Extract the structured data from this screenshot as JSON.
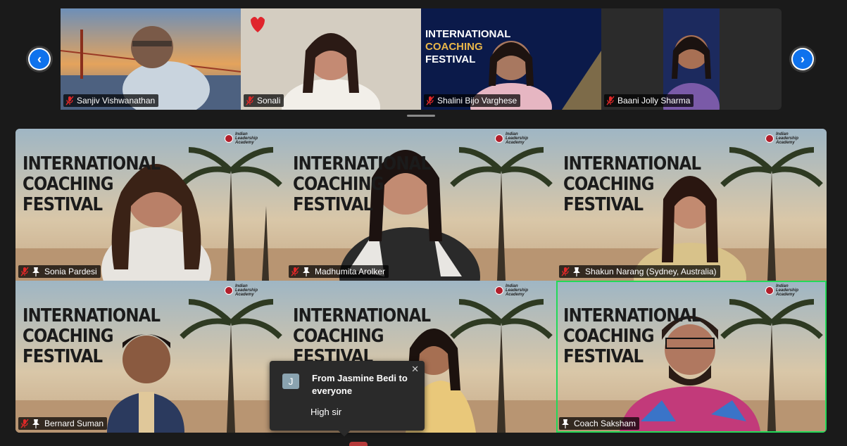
{
  "thumbnails": [
    {
      "name": "Sanjiv Vishwanathan"
    },
    {
      "name": "Sonali"
    },
    {
      "name": "Shalini Bijo Varghese",
      "banner_line1": "INTERNATIONAL",
      "banner_line2": "COACHING",
      "banner_line3": "FESTIVAL"
    },
    {
      "name": "Baani Jolly Sharma"
    }
  ],
  "gallery": [
    {
      "name": "Sonia Pardesi"
    },
    {
      "name": "Madhumita Arolker"
    },
    {
      "name": "Shakun Narang (Sydney, Australia)"
    },
    {
      "name": "Bernard Suman"
    },
    {
      "name": ""
    },
    {
      "name": "Coach Saksham"
    }
  ],
  "banner": {
    "line1": "INTERNATIONAL",
    "line2": "COACHING",
    "line3": "FESTIVAL"
  },
  "logo": {
    "line1": "Indian",
    "line2": "Leadership",
    "line3": "Academy"
  },
  "chat_popup": {
    "avatar_letter": "J",
    "from_text": "From Jasmine Bedi to everyone",
    "message": "High sir",
    "close_glyph": "✕"
  },
  "nav": {
    "prev_glyph": "‹",
    "next_glyph": "›"
  },
  "colors": {
    "accent_blue": "#0e72ed",
    "active_speaker": "#23d959",
    "muted_red": "#e02828"
  }
}
